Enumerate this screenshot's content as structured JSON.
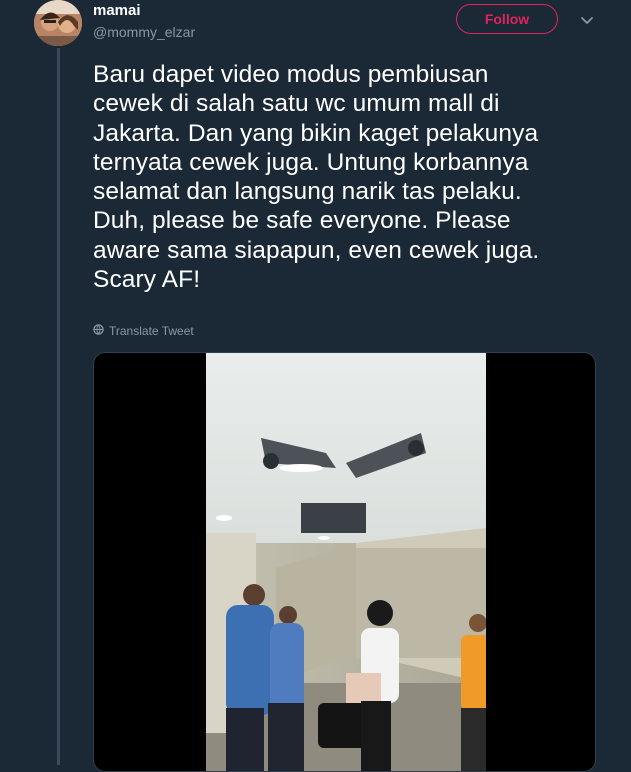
{
  "user": {
    "display_name": "mamai",
    "handle": "@mommy_elzar",
    "avatar_icon": "profile-photo"
  },
  "follow_button": {
    "label": "Follow"
  },
  "menu_icon": "chevron-down-icon",
  "tweet": {
    "lines": [
      "Baru dapet video modus pembiusan",
      "cewek di salah satu wc umum mall di",
      "Jakarta. Dan yang bikin kaget pelakunya",
      "ternyata cewek juga. Untung korbannya",
      "selamat dan langsung narik tas pelaku.",
      "Duh, please be safe everyone. Please",
      "aware sama siapapun, even cewek juga.",
      "Scary AF!"
    ]
  },
  "translate": {
    "label": "Translate Tweet",
    "icon": "globe-icon"
  },
  "media": {
    "kind": "video"
  },
  "colors": {
    "background": "#1b2836",
    "accent": "#e0245e",
    "muted_text": "#8899a6"
  }
}
